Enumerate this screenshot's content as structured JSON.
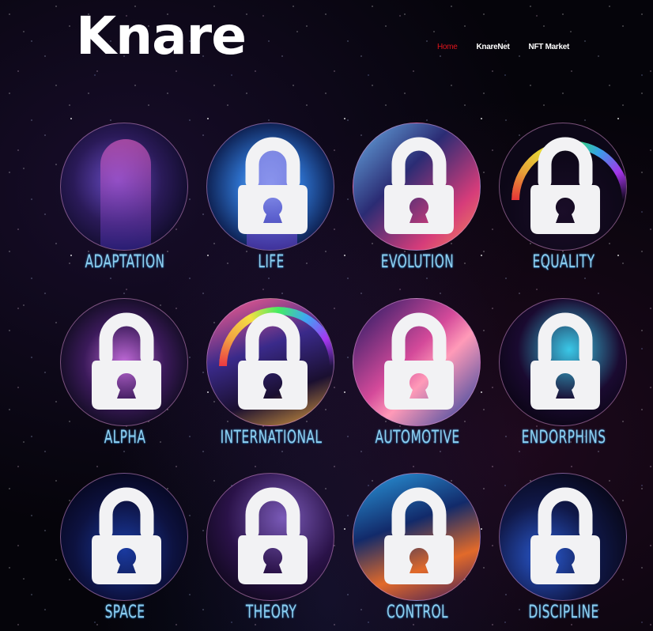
{
  "header": {
    "logo_text": "Knare",
    "nav": [
      {
        "label": "Home",
        "active": true
      },
      {
        "label": "KnareNet",
        "active": false
      },
      {
        "label": "NFT Market",
        "active": false
      }
    ]
  },
  "colors": {
    "nav_active": "#e0141c",
    "label_text": "#8fd0f0",
    "lock_fill": "#f2f2f4"
  },
  "cards": [
    {
      "label": "ADAPTATION",
      "locked": false
    },
    {
      "label": "LIFE",
      "locked": true
    },
    {
      "label": "EVOLUTION",
      "locked": true
    },
    {
      "label": "EQUALITY",
      "locked": true
    },
    {
      "label": "ALPHA",
      "locked": true
    },
    {
      "label": "INTERNATIONAL",
      "locked": true
    },
    {
      "label": "AUTOMOTIVE",
      "locked": true
    },
    {
      "label": "ENDORPHINS",
      "locked": true
    },
    {
      "label": "SPACE",
      "locked": true
    },
    {
      "label": "THEORY",
      "locked": true
    },
    {
      "label": "CONTROL",
      "locked": true
    },
    {
      "label": "DISCIPLINE",
      "locked": true
    }
  ],
  "icons": {
    "lock": "lock-icon"
  }
}
